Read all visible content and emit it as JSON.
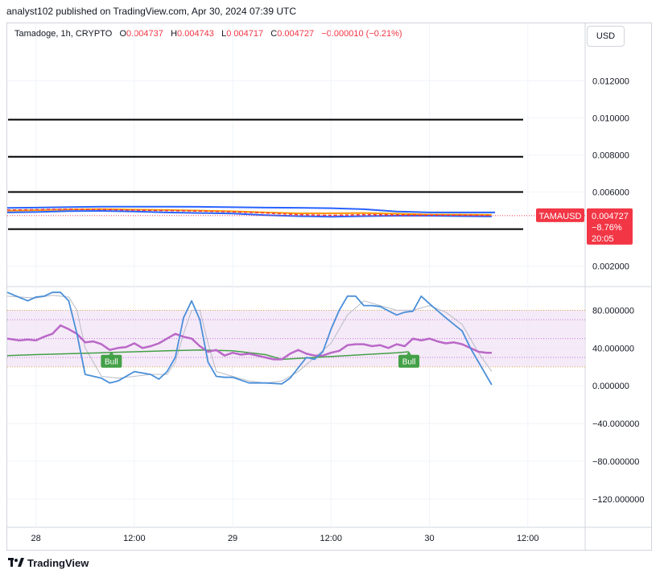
{
  "header": {
    "publisher_line": "analyst102 published on TradingView.com, Apr 30, 2024 07:39 UTC",
    "symbol": "Tamadoge, 1h, CRYPTO",
    "open_label": "O",
    "open": "0.004737",
    "high_label": "H",
    "high": "0.004743",
    "low_label": "L",
    "low": "0.004717",
    "close_label": "C",
    "close": "0.004727",
    "change": "−0.000010 (−0.21%)"
  },
  "currency_button": "USD",
  "footer": {
    "brand": "TradingView"
  },
  "colors": {
    "down": "#f23645",
    "upper_band": "#2962ff",
    "middle_band": "#ff9800",
    "rsi": "#ba68c8",
    "rsi_ma": "#43a047",
    "stoch_k": "#4a8fd9",
    "stoch_d": "#b8bcc6",
    "level_line": "#000000",
    "rsi_band_fill": "#f3e5f5"
  },
  "chart_data": [
    {
      "type": "line",
      "panel": "price",
      "y_axis_ticks": [
        "0.012000",
        "0.010000",
        "0.008000",
        "0.006000",
        "0.002000"
      ],
      "y_tick_values": [
        0.012,
        0.01,
        0.008,
        0.006,
        0.002
      ],
      "ylim": [
        0.0009,
        0.01375
      ],
      "x_tick_labels": [
        "28",
        "12:00",
        "29",
        "12:00",
        "30",
        "12:00"
      ],
      "x_tick_positions": [
        0,
        12,
        24,
        36,
        48,
        60
      ],
      "xlim": [
        -3.5,
        67
      ],
      "horizontal_levels": [
        0.0099,
        0.0079,
        0.006,
        0.004
      ],
      "price_label": {
        "symbol": "TAMAUSD",
        "price": "0.004727",
        "change_pct": "−8.76%",
        "countdown": "20:05"
      },
      "last_price": 0.004727,
      "series": [
        {
          "name": "upper band",
          "x": [
            -3.5,
            0,
            4,
            8,
            12,
            16,
            20,
            24,
            28,
            32,
            36,
            40,
            44,
            48,
            52,
            56,
            55.6
          ],
          "y": [
            0.00514,
            0.00516,
            0.00519,
            0.00521,
            0.00521,
            0.00521,
            0.0052,
            0.00518,
            0.00516,
            0.00515,
            0.00513,
            0.00507,
            0.00495,
            0.0049,
            0.0049,
            0.0049,
            0.0049
          ]
        },
        {
          "name": "middle band",
          "x": [
            -3.5,
            0,
            4,
            8,
            12,
            16,
            20,
            24,
            28,
            32,
            36,
            40,
            44,
            48,
            52,
            55.6
          ],
          "y": [
            0.005,
            0.00502,
            0.00506,
            0.00508,
            0.00505,
            0.00503,
            0.005,
            0.00496,
            0.0049,
            0.00485,
            0.00485,
            0.00487,
            0.00483,
            0.00478,
            0.00478,
            0.00477
          ]
        },
        {
          "name": "lower band",
          "x": [
            -3.5,
            0,
            4,
            8,
            12,
            16,
            20,
            24,
            28,
            32,
            36,
            40,
            44,
            48,
            52,
            55.6
          ],
          "y": [
            0.0049,
            0.00492,
            0.00497,
            0.00498,
            0.00495,
            0.0049,
            0.00487,
            0.00484,
            0.00475,
            0.0047,
            0.00467,
            0.0047,
            0.00472,
            0.00472,
            0.0047,
            0.00468
          ]
        },
        {
          "name": "price",
          "x": [
            -3.5,
            0,
            4,
            8,
            12,
            16,
            20,
            24,
            28,
            32,
            36,
            40,
            44,
            48,
            52,
            55.6
          ],
          "y": [
            0.00503,
            0.00505,
            0.00507,
            0.00506,
            0.00502,
            0.005,
            0.00497,
            0.00493,
            0.00487,
            0.00478,
            0.00474,
            0.00478,
            0.00477,
            0.00475,
            0.00475,
            0.004727
          ]
        }
      ]
    },
    {
      "type": "line",
      "panel": "oscillator",
      "y_axis_ticks": [
        "80.000000",
        "40.000000",
        "0.000000",
        "−40.000000",
        "−80.000000",
        "−120.000000"
      ],
      "y_tick_values": [
        80,
        40,
        0,
        -40,
        -80,
        -120
      ],
      "ylim": [
        -150,
        100
      ],
      "xlim": [
        -3.5,
        67
      ],
      "reference_lines": [
        80,
        70,
        50,
        30,
        20
      ],
      "rsi_band": [
        20,
        80
      ],
      "signal_labels": [
        {
          "text": "Bull",
          "x": 9.2,
          "y": 26
        },
        {
          "text": "Bull",
          "x": 45.5,
          "y": 26
        }
      ],
      "series": [
        {
          "name": "stoch_k",
          "x": [
            -3.5,
            -1,
            0,
            1,
            2,
            3,
            4,
            5,
            6,
            8,
            9,
            10,
            12,
            14,
            15,
            16,
            17,
            18,
            19,
            20,
            21,
            22,
            23,
            24,
            26,
            28,
            30,
            31,
            33,
            34,
            35,
            36,
            37,
            38,
            39,
            40,
            41,
            42,
            44,
            45,
            46,
            47,
            48,
            50,
            52,
            53,
            55.6
          ],
          "y": [
            99,
            90,
            94,
            95,
            99,
            99,
            90,
            55,
            12,
            8,
            3,
            5,
            15,
            12,
            7,
            15,
            30,
            72,
            90,
            70,
            25,
            10,
            9,
            9,
            3,
            3,
            2,
            8,
            30,
            28,
            36,
            60,
            80,
            95,
            95,
            85,
            85,
            84,
            75,
            78,
            79,
            95,
            87,
            72,
            58,
            40,
            1
          ]
        },
        {
          "name": "stoch_d",
          "x": [
            -3.5,
            0,
            2,
            4,
            5,
            6,
            8,
            10,
            12,
            14,
            16,
            17,
            18,
            19,
            20,
            21,
            22,
            24,
            26,
            28,
            30,
            32,
            34,
            36,
            38,
            40,
            42,
            44,
            46,
            48,
            50,
            52,
            54,
            55.6
          ],
          "y": [
            95,
            93,
            96,
            94,
            80,
            40,
            10,
            8,
            10,
            12,
            12,
            25,
            55,
            80,
            80,
            45,
            15,
            10,
            5,
            3,
            5,
            15,
            30,
            45,
            75,
            90,
            85,
            80,
            80,
            85,
            78,
            65,
            35,
            15
          ]
        },
        {
          "name": "rsi",
          "x": [
            -3.5,
            -2,
            -1,
            0,
            1,
            2,
            3,
            4,
            5,
            6,
            7,
            8,
            9,
            10,
            11,
            12,
            13,
            14,
            15,
            16,
            17,
            18,
            19,
            20,
            21,
            22,
            23,
            24,
            25,
            26,
            27,
            28,
            29,
            30,
            31,
            32,
            33,
            34,
            35,
            36,
            37,
            38,
            39,
            40,
            41,
            42,
            43,
            44,
            45,
            46,
            47,
            48,
            49,
            50,
            51,
            52,
            53,
            54,
            55,
            55.6
          ],
          "y": [
            50,
            48,
            49,
            48,
            52,
            55,
            64,
            60,
            55,
            46,
            47,
            44,
            38,
            40,
            41,
            45,
            40,
            42,
            45,
            50,
            55,
            52,
            50,
            42,
            36,
            38,
            32,
            35,
            33,
            34,
            32,
            30,
            28,
            28,
            34,
            38,
            34,
            32,
            32,
            35,
            37,
            43,
            44,
            44,
            42,
            43,
            40,
            44,
            42,
            50,
            48,
            50,
            47,
            45,
            46,
            44,
            40,
            36,
            35,
            35
          ]
        },
        {
          "name": "rsi_ma",
          "x": [
            -3.5,
            0,
            4,
            8,
            12,
            16,
            20,
            24,
            28,
            30,
            32,
            36,
            40,
            44,
            45.5
          ],
          "y": [
            32,
            33,
            34,
            35,
            36,
            37,
            38,
            37,
            33,
            28,
            29,
            31,
            33,
            35,
            36
          ]
        }
      ]
    }
  ]
}
